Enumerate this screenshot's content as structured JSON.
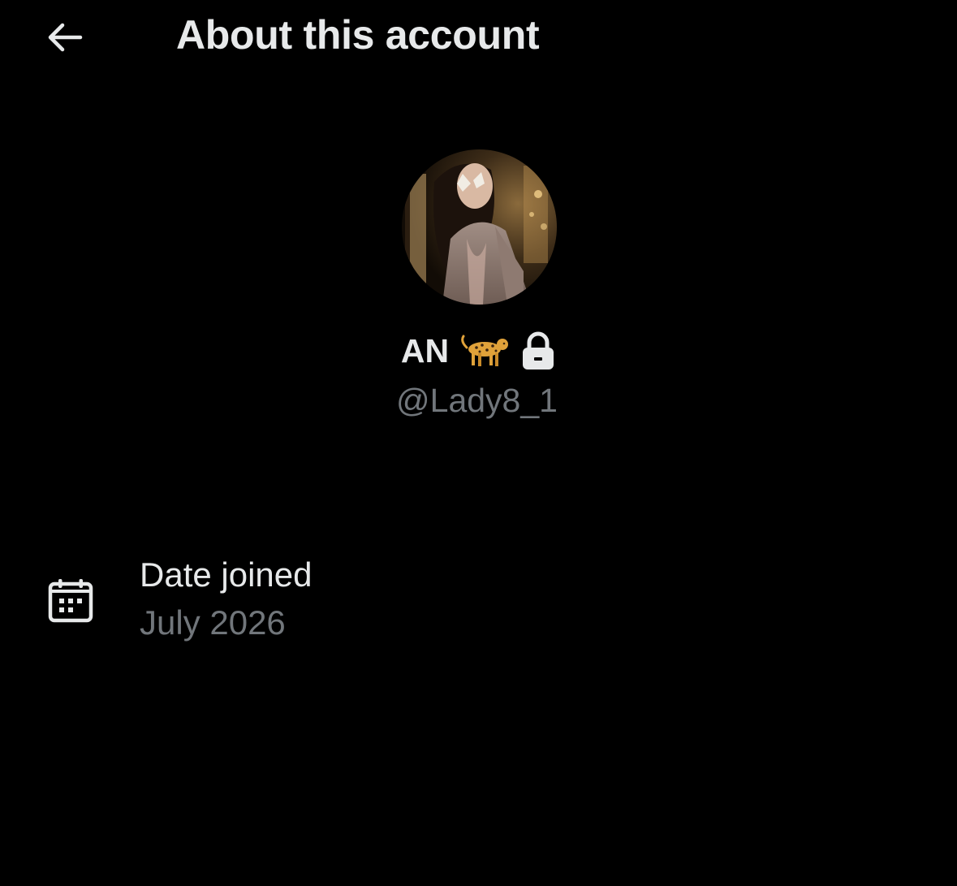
{
  "header": {
    "title": "About this account",
    "back_icon": "arrow-left-icon"
  },
  "profile": {
    "display_name": "AN",
    "name_emoji": "🐆",
    "lock_icon": "lock-icon",
    "username": "@Lady8_1"
  },
  "details": {
    "date_joined": {
      "icon": "calendar-icon",
      "label": "Date joined",
      "value": "July 2026"
    }
  },
  "colors": {
    "background": "#000000",
    "primary_text": "#e7e9ea",
    "secondary_text": "#71767b"
  }
}
